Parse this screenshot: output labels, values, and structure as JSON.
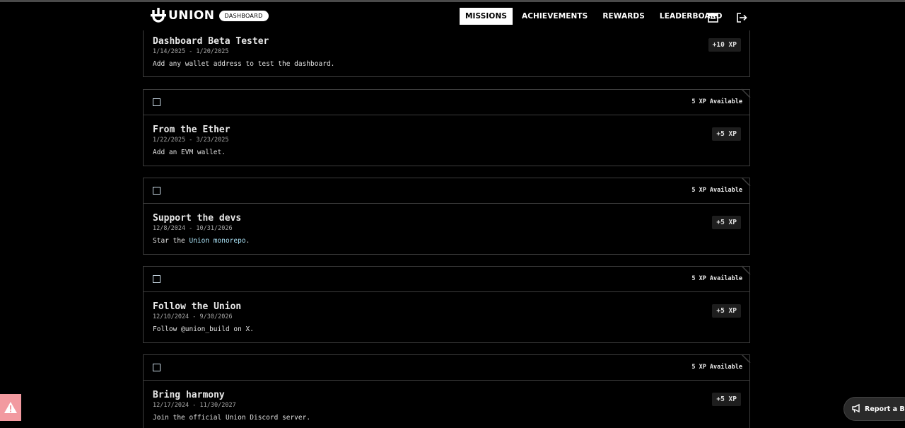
{
  "header": {
    "logo_text": "UNION",
    "badge": "DASHBOARD",
    "nav": [
      "MISSIONS",
      "ACHIEVEMENTS",
      "REWARDS",
      "LEADERBOARD"
    ],
    "active_nav": "MISSIONS"
  },
  "missions": [
    {
      "title": "Dashboard Beta Tester",
      "dates": "1/14/2025 - 1/20/2025",
      "description": "Add any wallet address to test the dashboard.",
      "xp": "+10 XP"
    },
    {
      "available": "5 XP Available",
      "title": "From the Ether",
      "dates": "1/22/2025 - 3/23/2025",
      "description": "Add an EVM wallet.",
      "xp": "+5 XP"
    },
    {
      "available": "5 XP Available",
      "title": "Support the devs",
      "dates": "12/8/2024 - 10/31/2026",
      "description_prefix": "Star the ",
      "description_link": "Union monorepo",
      "description_suffix": ".",
      "xp": "+5 XP"
    },
    {
      "available": "5 XP Available",
      "title": "Follow the Union",
      "dates": "12/10/2024 - 9/30/2026",
      "description": "Follow @union_build on X.",
      "xp": "+5 XP"
    },
    {
      "available": "5 XP Available",
      "title": "Bring harmony",
      "dates": "12/17/2024 - 11/30/2027",
      "description": "Join the official Union Discord server.",
      "xp": "+5 XP"
    }
  ],
  "report_bug": "Report a Bug",
  "icons": [
    "union-logo-icon",
    "inbox-icon",
    "logout-icon",
    "warning-icon",
    "megaphone-icon"
  ],
  "colors": {
    "background": "#000000",
    "border": "#3d3d3d",
    "link": "#a9e0f4",
    "warning": "#f29aa0"
  }
}
